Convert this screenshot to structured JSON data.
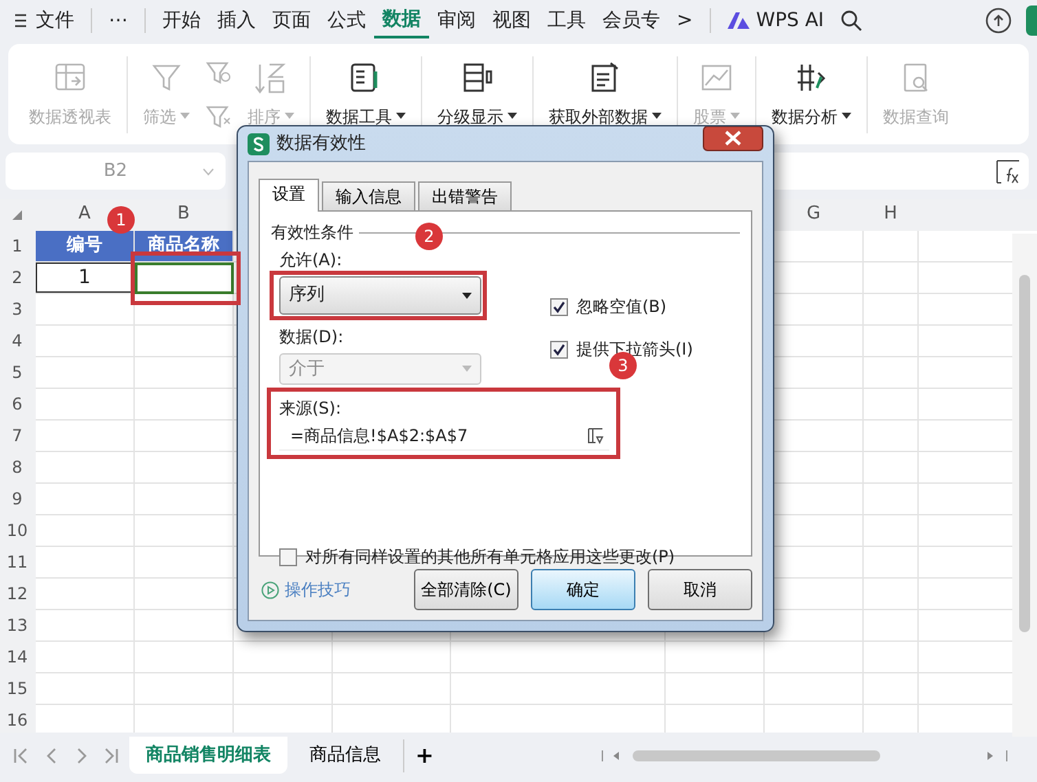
{
  "menu": {
    "file": "文件",
    "more": "⋯",
    "overflow": ">",
    "ai": "WPS AI",
    "tabs": [
      {
        "label": "开始",
        "selected": false
      },
      {
        "label": "插入",
        "selected": false
      },
      {
        "label": "页面",
        "selected": false
      },
      {
        "label": "公式",
        "selected": false
      },
      {
        "label": "数据",
        "selected": true
      },
      {
        "label": "审阅",
        "selected": false
      },
      {
        "label": "视图",
        "selected": false
      },
      {
        "label": "工具",
        "selected": false
      },
      {
        "label": "会员专",
        "selected": false
      }
    ]
  },
  "ribbon": [
    {
      "items": [
        {
          "kind": "large",
          "label": "数据透视表",
          "disabled": true,
          "dropdown": false
        }
      ]
    },
    {
      "items": [
        {
          "kind": "large",
          "label": "筛选",
          "disabled": true,
          "dropdown": true
        },
        {
          "kind": "icons",
          "disabled": true
        },
        {
          "kind": "large",
          "label": "排序",
          "disabled": true,
          "dropdown": true
        }
      ]
    },
    {
      "items": [
        {
          "kind": "large",
          "label": "数据工具",
          "disabled": false,
          "dropdown": true
        }
      ]
    },
    {
      "items": [
        {
          "kind": "large",
          "label": "分级显示",
          "disabled": false,
          "dropdown": true
        }
      ]
    },
    {
      "items": [
        {
          "kind": "large",
          "label": "获取外部数据",
          "disabled": false,
          "dropdown": true
        }
      ]
    },
    {
      "items": [
        {
          "kind": "large",
          "label": "股票",
          "disabled": true,
          "dropdown": true
        }
      ]
    },
    {
      "items": [
        {
          "kind": "large",
          "label": "数据分析",
          "disabled": false,
          "dropdown": true
        }
      ]
    },
    {
      "items": [
        {
          "kind": "large",
          "label": "数据查询",
          "disabled": true,
          "dropdown": false
        }
      ]
    }
  ],
  "formula_bar": {
    "cell": "B2"
  },
  "sheet": {
    "columns": [
      {
        "label": "A"
      },
      {
        "label": "B"
      },
      {
        "label": "G"
      },
      {
        "label": "H"
      }
    ],
    "row_numbers": [
      "1",
      "2",
      "3",
      "4",
      "5",
      "6",
      "7",
      "8",
      "9",
      "10",
      "11",
      "12",
      "13",
      "14",
      "15",
      "16"
    ],
    "rows": [
      [
        {
          "kind": "header",
          "text": "编号",
          "selected": false
        },
        {
          "kind": "header",
          "text": "商品名称",
          "selected": false
        }
      ],
      [
        {
          "kind": "data",
          "text": "1",
          "selected": false
        },
        {
          "kind": "data",
          "selected": true
        }
      ]
    ]
  },
  "sheet_tabs": [
    {
      "label": "商品销售明细表",
      "selected": true
    },
    {
      "label": "商品信息",
      "selected": false
    }
  ],
  "add_sheet": "+",
  "dialog": {
    "title": "数据有效性",
    "tabs": [
      {
        "label": "设置",
        "selected": true
      },
      {
        "label": "输入信息",
        "selected": false
      },
      {
        "label": "出错警告",
        "selected": false
      }
    ],
    "section": "有效性条件",
    "allow_label": "允许(A):",
    "allow_value": "序列",
    "data_label": "数据(D):",
    "data_value": "介于",
    "data_disabled": true,
    "checkboxes": [
      {
        "label": "忽略空值(B)",
        "checked": true
      },
      {
        "label": "提供下拉箭头(I)",
        "checked": true
      }
    ],
    "source_label": "来源(S):",
    "source_value": "=商品信息!$A$2:$A$7",
    "apply_all": {
      "label": "对所有同样设置的其他所有单元格应用这些更改(P)",
      "checked": false
    },
    "tips": "操作技巧",
    "buttons": [
      {
        "label": "全部清除(C)",
        "kind": "normal"
      },
      {
        "label": "确定",
        "kind": "default"
      },
      {
        "label": "取消",
        "kind": "normal"
      }
    ]
  },
  "annotations": [
    {
      "number": "1"
    },
    {
      "number": "2"
    },
    {
      "number": "3"
    }
  ]
}
